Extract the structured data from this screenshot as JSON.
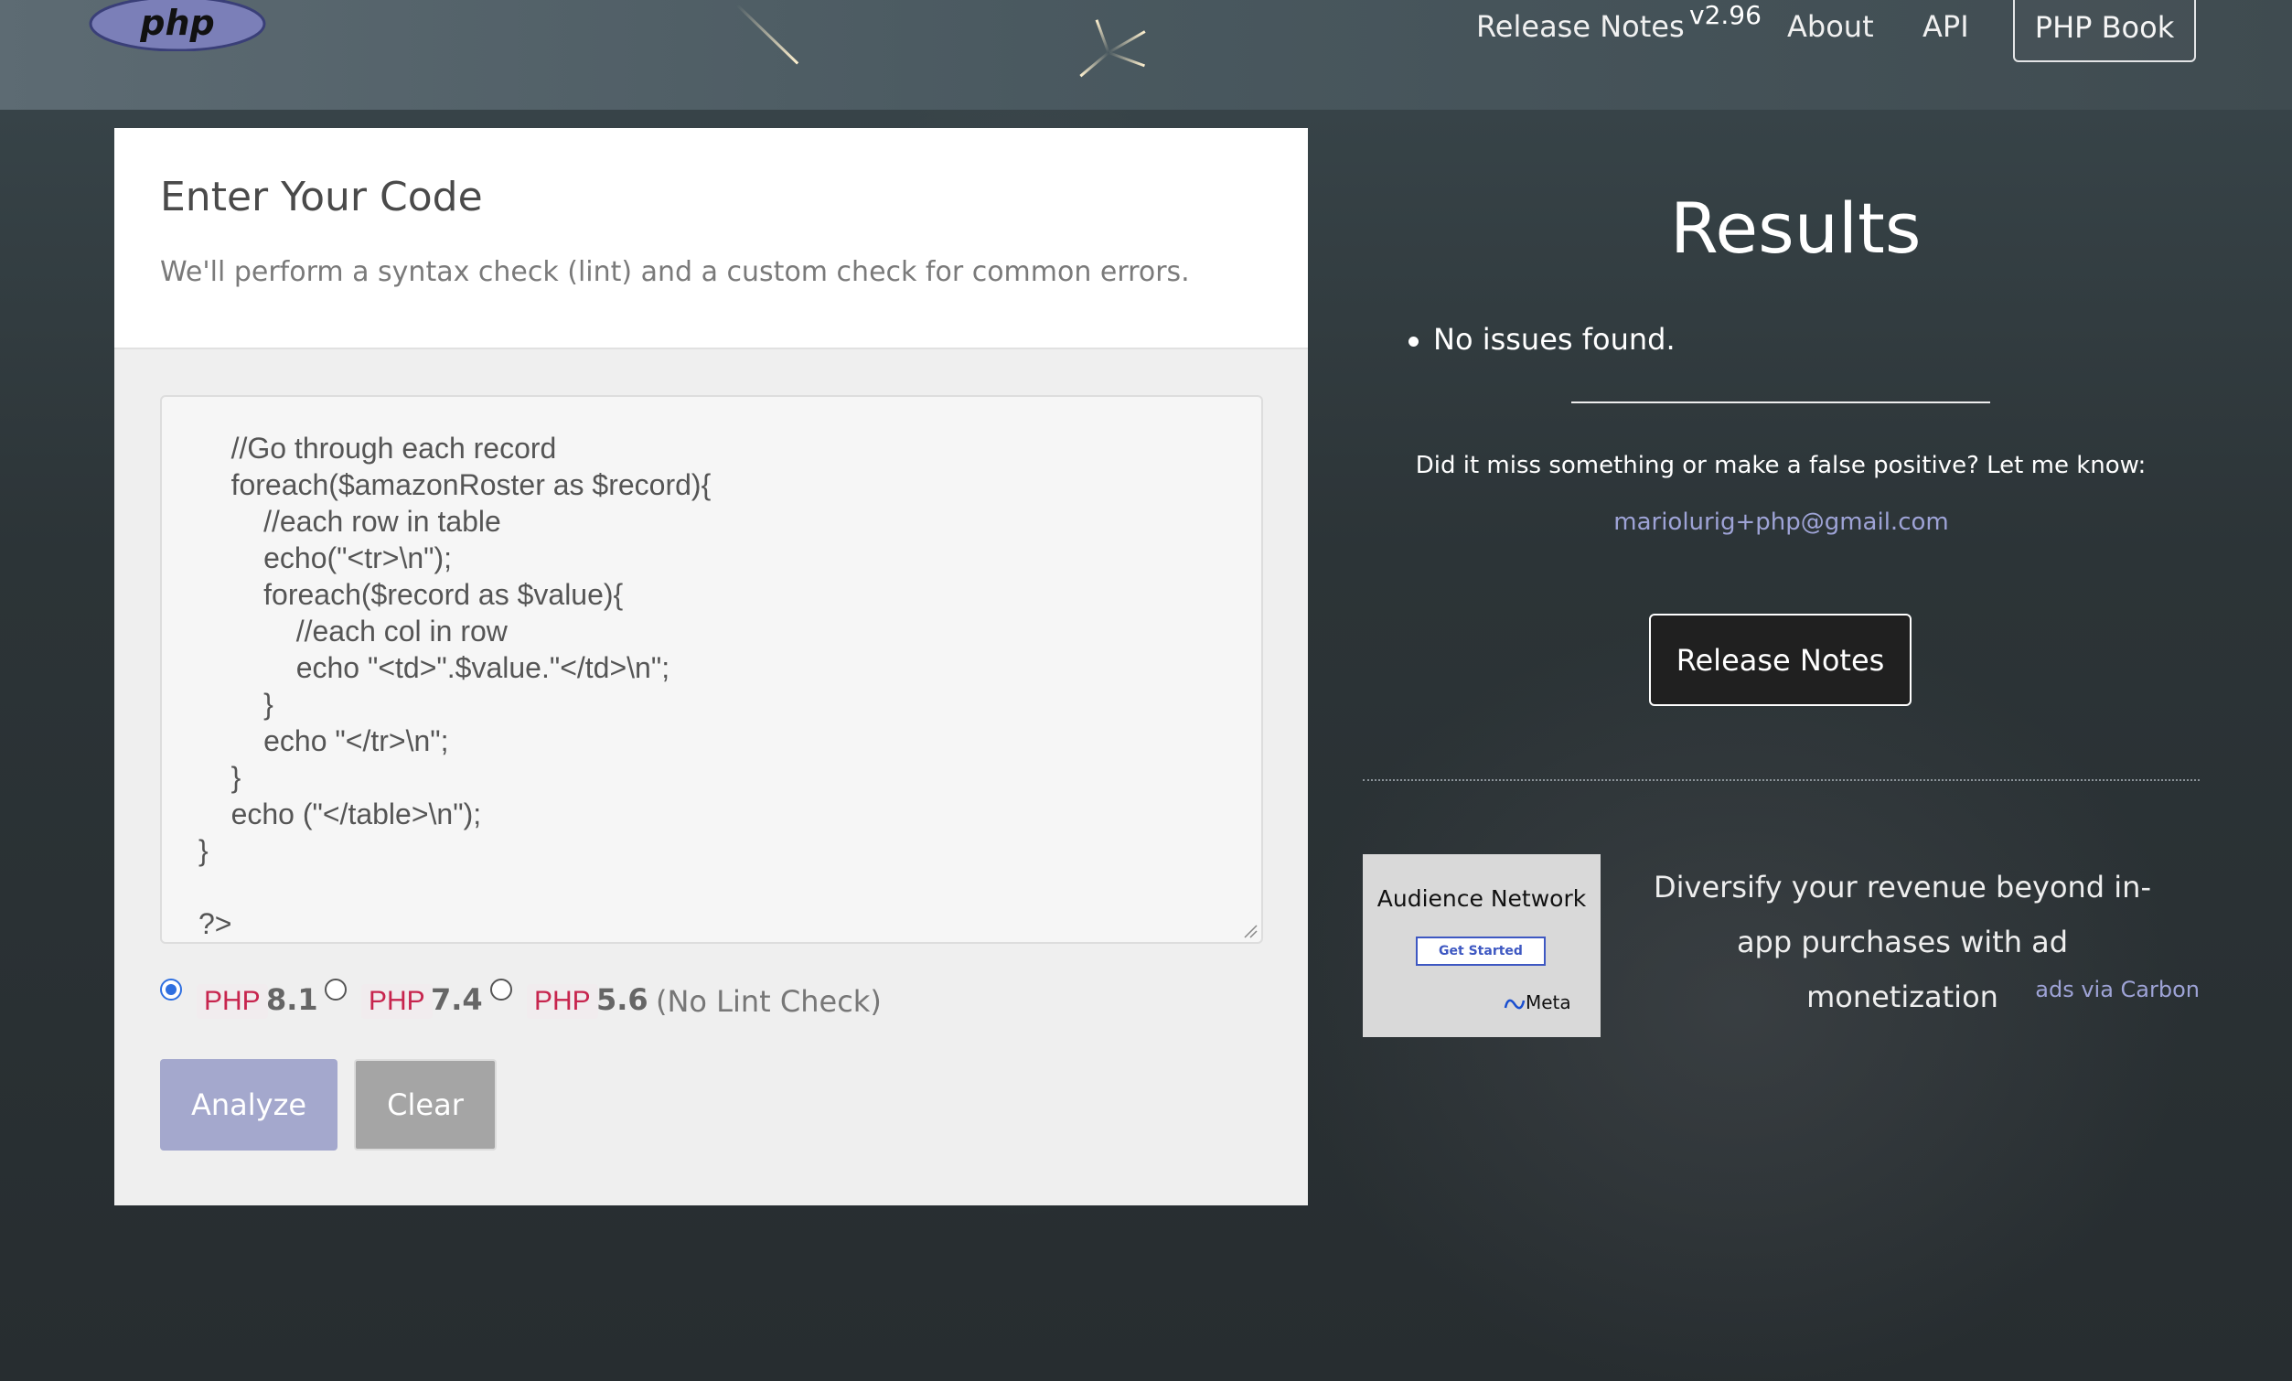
{
  "nav": {
    "logo_text": "php",
    "release_notes": "Release Notes",
    "version": "v2.96",
    "about": "About",
    "api": "API",
    "php_book": "PHP Book"
  },
  "card": {
    "title": "Enter Your Code",
    "subtitle": "We'll perform a syntax check (lint) and a custom check for common errors.",
    "code_lines": [
      "    //Go through each record",
      "    foreach($amazonRoster as $record){",
      "        //each row in table",
      "        echo(\"<tr>\\n\");",
      "        foreach($record as $value){",
      "            //each col in row",
      "            echo \"<td>\".$value.\"</td>\\n\";",
      "        }",
      "        echo \"</tr>\\n\";",
      "    }",
      "    echo (\"</table>\\n\");",
      "}",
      "",
      "?>"
    ],
    "versions": [
      {
        "tag": "PHP",
        "number": "8.1",
        "note": "",
        "selected": true
      },
      {
        "tag": "PHP",
        "number": "7.4",
        "note": "",
        "selected": false
      },
      {
        "tag": "PHP",
        "number": "5.6",
        "note": "(No Lint Check)",
        "selected": false
      }
    ],
    "analyze_label": "Analyze",
    "clear_label": "Clear"
  },
  "results": {
    "title": "Results",
    "items": [
      "No issues found."
    ],
    "feedback": "Did it miss something or make a false positive? Let me know:",
    "email": "mariolurig+php@gmail.com",
    "release_notes_button": "Release Notes"
  },
  "ad": {
    "image_title": "Audience Network",
    "image_cta": "Get Started",
    "image_brand": "Meta",
    "text": "Diversify your revenue beyond in-app purchases with ad monetization",
    "via": "ads via Carbon"
  },
  "colors": {
    "accent_link": "#9ea3d6",
    "analyze_button": "#a4a8cd",
    "php_tag": "#c7254e",
    "radio_selected": "#2f6fe0"
  }
}
